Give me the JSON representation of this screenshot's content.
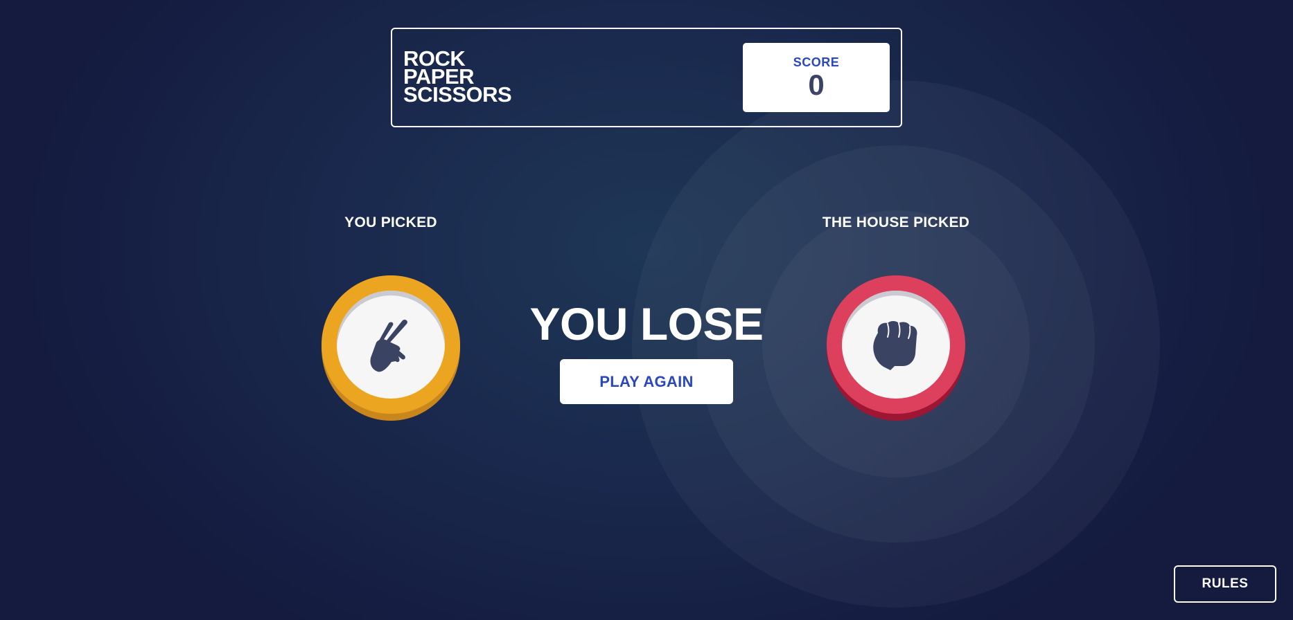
{
  "header": {
    "logo_lines": [
      "ROCK",
      "PAPER",
      "SCISSORS"
    ],
    "score_label": "SCORE",
    "score_value": "0"
  },
  "game": {
    "you_label": "YOU PICKED",
    "house_label": "THE HOUSE PICKED",
    "you_pick": "scissors",
    "house_pick": "rock",
    "result": "YOU LOSE",
    "play_again_label": "PLAY AGAIN"
  },
  "footer": {
    "rules_label": "RULES"
  },
  "colors": {
    "scissors": "#eca521",
    "rock": "#dd405d",
    "score_label": "#2a46c0",
    "score_value": "#3b4363",
    "icon": "#3b4363"
  },
  "icons": {
    "you_pick_icon": "scissors-hand-icon",
    "house_pick_icon": "rock-fist-icon"
  }
}
